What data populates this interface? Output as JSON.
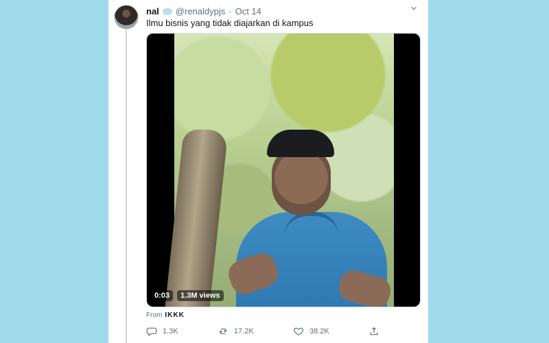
{
  "tweet": {
    "author_name": "nal",
    "author_badge_icon": "chat-bubble-icon",
    "handle": "@renaldypjs",
    "separator": "·",
    "date": "Oct 14",
    "text": "Ilmu bisnis yang tidak diajarkan di kampus",
    "media": {
      "duration": "0:03",
      "views": "1.3M views"
    },
    "source_prefix": "From",
    "source_app": "IKKK",
    "actions": {
      "reply_count": "1.3K",
      "retweet_count": "17.2K",
      "like_count": "38.2K"
    }
  },
  "colors": {
    "background": "#9fd9ea",
    "card": "#ffffff",
    "text_primary": "#0f1419",
    "text_secondary": "#5b7083"
  }
}
